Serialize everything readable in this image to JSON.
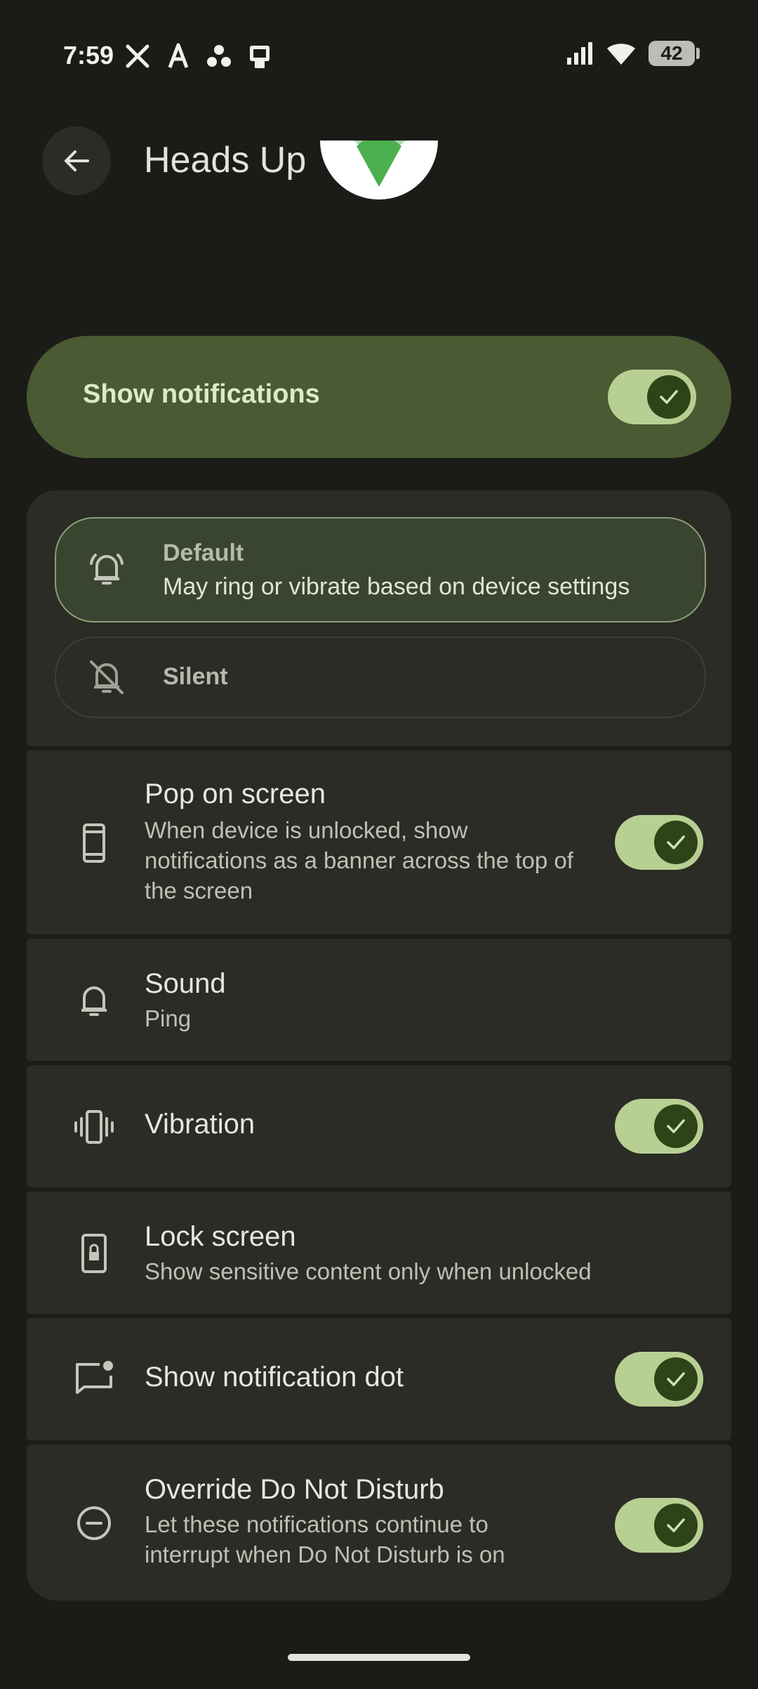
{
  "status": {
    "time": "7:59",
    "battery": "42"
  },
  "header": {
    "title": "Heads Up"
  },
  "main_toggle": {
    "label": "Show notifications",
    "on": true
  },
  "behavior": {
    "default": {
      "title": "Default",
      "subtitle": "May ring or vibrate based on device settings",
      "selected": true
    },
    "silent": {
      "title": "Silent",
      "selected": false
    }
  },
  "settings": {
    "pop_on_screen": {
      "title": "Pop on screen",
      "subtitle": "When device is unlocked, show notifications as a banner across the top of the screen",
      "on": true
    },
    "sound": {
      "title": "Sound",
      "subtitle": "Ping"
    },
    "vibration": {
      "title": "Vibration",
      "on": true
    },
    "lock_screen": {
      "title": "Lock screen",
      "subtitle": "Show sensitive content only when unlocked"
    },
    "notification_dot": {
      "title": "Show notification dot",
      "on": true
    },
    "override_dnd": {
      "title": "Override Do Not Disturb",
      "subtitle": "Let these notifications continue to interrupt when Do Not Disturb is on",
      "on": true
    }
  },
  "colors": {
    "accent_card": "#4a5a32",
    "toggle_track": "#b8cf93",
    "toggle_knob": "#2f4318",
    "background": "#1b1c18",
    "surface": "#2a2c25"
  }
}
